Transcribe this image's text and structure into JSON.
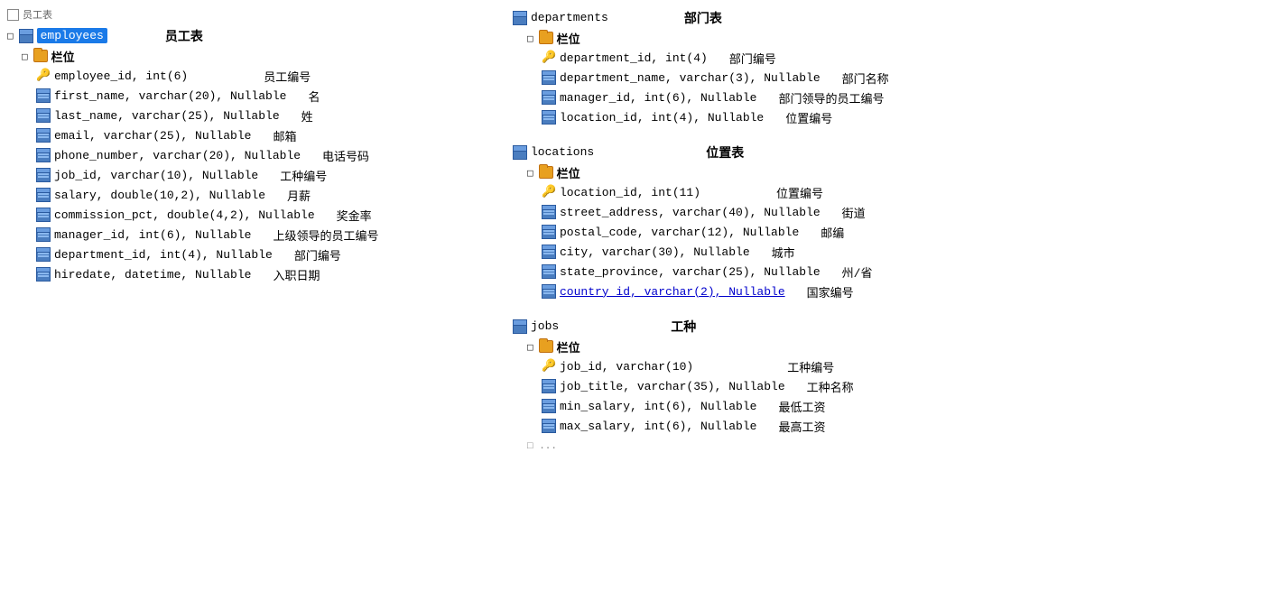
{
  "left": {
    "top_label": "员工表",
    "table_name": "employees",
    "section_label": "栏位",
    "fields": [
      {
        "icon": "key",
        "name": "employee_id, int(6)",
        "comment": "员工编号"
      },
      {
        "icon": "col",
        "name": "first_name, varchar(20), Nullable",
        "comment": "名"
      },
      {
        "icon": "col",
        "name": "last_name, varchar(25), Nullable",
        "comment": "姓"
      },
      {
        "icon": "col",
        "name": "email, varchar(25), Nullable",
        "comment": "邮箱"
      },
      {
        "icon": "col",
        "name": "phone_number, varchar(20), Nullable",
        "comment": "电话号码"
      },
      {
        "icon": "col",
        "name": "job_id, varchar(10), Nullable",
        "comment": "工种编号"
      },
      {
        "icon": "col",
        "name": "salary, double(10,2), Nullable",
        "comment": "月薪"
      },
      {
        "icon": "col",
        "name": "commission_pct, double(4,2), Nullable",
        "comment": "奖金率"
      },
      {
        "icon": "col",
        "name": "manager_id, int(6), Nullable",
        "comment": "上级领导的员工编号"
      },
      {
        "icon": "col",
        "name": "department_id, int(4), Nullable",
        "comment": "部门编号"
      },
      {
        "icon": "col",
        "name": "hiredate, datetime, Nullable",
        "comment": "入职日期"
      }
    ]
  },
  "departments": {
    "table_name": "departments",
    "top_label": "部门表",
    "section_label": "栏位",
    "fields": [
      {
        "icon": "key",
        "name": "department_id, int(4)",
        "comment": "部门编号"
      },
      {
        "icon": "col",
        "name": "department_name, varchar(3), Nullable",
        "comment": "部门名称"
      },
      {
        "icon": "col",
        "name": "manager_id, int(6), Nullable",
        "comment": "部门领导的员工编号"
      },
      {
        "icon": "col",
        "name": "location_id, int(4), Nullable",
        "comment": "位置编号"
      }
    ]
  },
  "locations": {
    "table_name": "locations",
    "top_label": "位置表",
    "section_label": "栏位",
    "fields": [
      {
        "icon": "key",
        "name": "location_id, int(11)",
        "comment": "位置编号"
      },
      {
        "icon": "col",
        "name": "street_address, varchar(40), Nullable",
        "comment": "街道"
      },
      {
        "icon": "col",
        "name": "postal_code, varchar(12), Nullable",
        "comment": "邮编"
      },
      {
        "icon": "col",
        "name": "city, varchar(30), Nullable",
        "comment": "城市"
      },
      {
        "icon": "col",
        "name": "state_province, varchar(25), Nullable",
        "comment": "州/省"
      },
      {
        "icon": "col",
        "name": "country_id, varchar(2), Nullable",
        "comment": "国家编号",
        "link": true
      }
    ]
  },
  "jobs": {
    "table_name": "jobs",
    "top_label": "工种",
    "section_label": "栏位",
    "fields": [
      {
        "icon": "key",
        "name": "job_id, varchar(10)",
        "comment": "工种编号"
      },
      {
        "icon": "col",
        "name": "job_title, varchar(35), Nullable",
        "comment": "工种名称"
      },
      {
        "icon": "col",
        "name": "min_salary, int(6), Nullable",
        "comment": "最低工资"
      },
      {
        "icon": "col",
        "name": "max_salary, int(6), Nullable",
        "comment": "最高工资"
      }
    ]
  }
}
